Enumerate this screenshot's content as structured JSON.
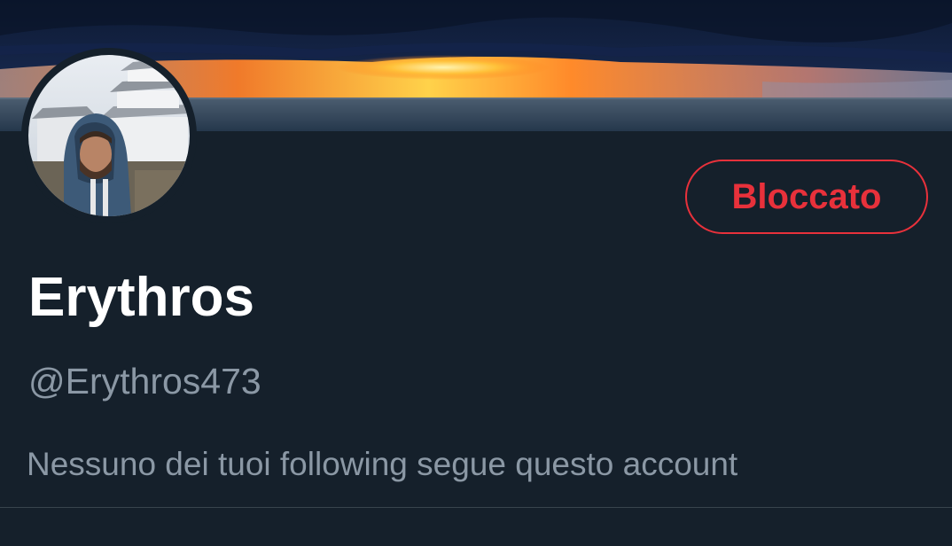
{
  "profile": {
    "display_name": "Erythros",
    "handle": "@Erythros473",
    "followers_note": "Nessuno dei tuoi following segue questo account"
  },
  "actions": {
    "blocked_label": "Bloccato"
  },
  "colors": {
    "background": "#15202b",
    "blocked_accent": "#e8313b",
    "secondary_text": "#8b98a5",
    "primary_text": "#ffffff"
  },
  "images": {
    "banner": "sunset-over-sea-banner",
    "avatar": "person-in-hood-in-front-of-castle"
  }
}
